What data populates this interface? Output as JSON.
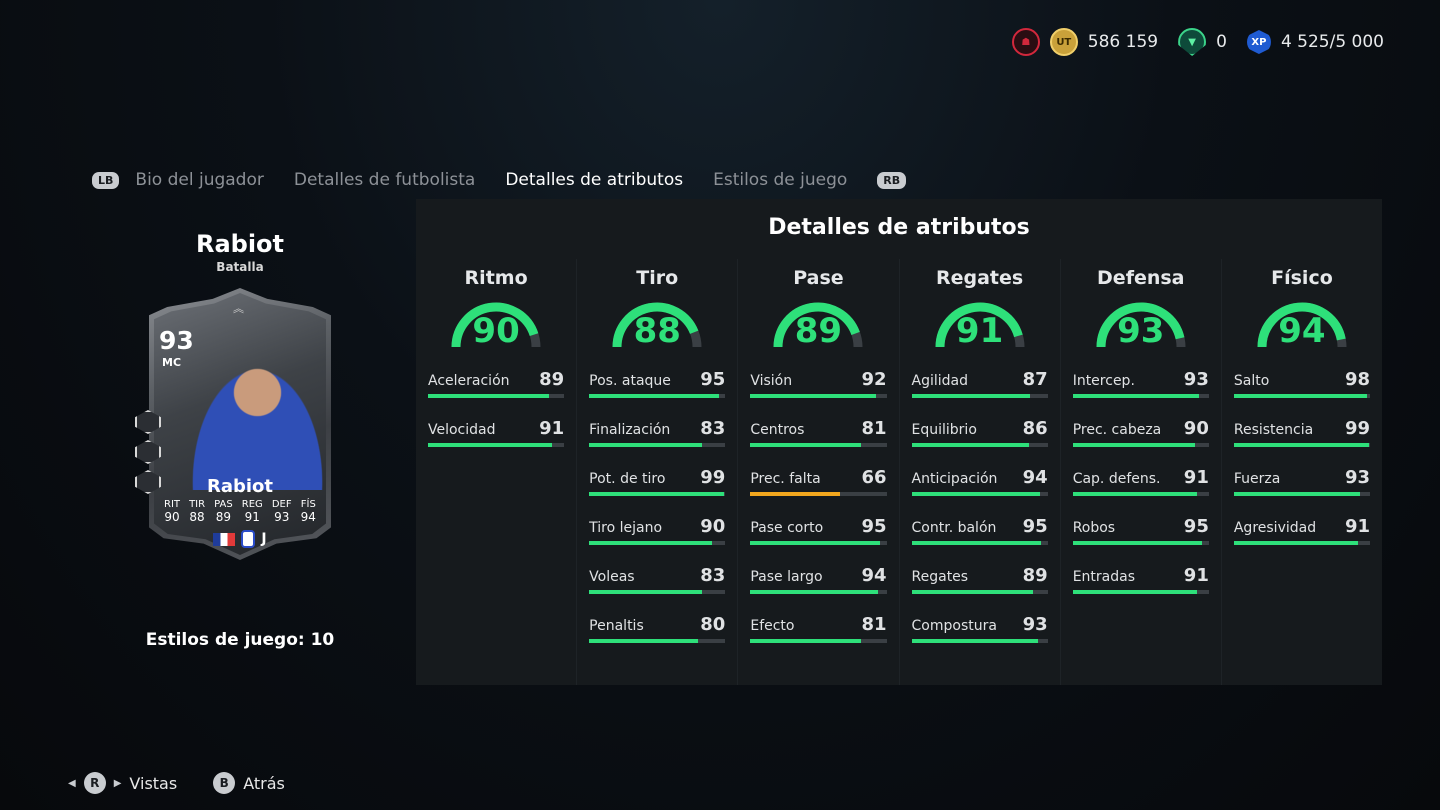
{
  "currency": {
    "coins": "586 159",
    "points": "0",
    "xp": "4 525/5 000",
    "coin_icon_text": "UT",
    "xp_icon_text": "XP"
  },
  "tabs": {
    "lb": "LB",
    "rb": "RB",
    "items": [
      {
        "label": "Bio del jugador",
        "active": false
      },
      {
        "label": "Detalles de futbolista",
        "active": false
      },
      {
        "label": "Detalles de atributos",
        "active": true
      },
      {
        "label": "Estilos de juego",
        "active": false
      }
    ]
  },
  "player": {
    "name": "Rabiot",
    "subtitle": "Batalla",
    "card": {
      "overall": "93",
      "position": "MC",
      "name": "Rabiot",
      "stats": [
        {
          "label": "RIT",
          "value": "90"
        },
        {
          "label": "TIR",
          "value": "88"
        },
        {
          "label": "PAS",
          "value": "89"
        },
        {
          "label": "REG",
          "value": "91"
        },
        {
          "label": "DEF",
          "value": "93"
        },
        {
          "label": "FÍS",
          "value": "94"
        }
      ]
    },
    "playstyles": "Estilos de juego: 10"
  },
  "panel": {
    "title": "Detalles de atributos",
    "categories": [
      {
        "name": "Ritmo",
        "value": 90,
        "attrs": [
          {
            "label": "Aceleración",
            "value": 89
          },
          {
            "label": "Velocidad",
            "value": 91
          }
        ]
      },
      {
        "name": "Tiro",
        "value": 88,
        "attrs": [
          {
            "label": "Pos. ataque",
            "value": 95
          },
          {
            "label": "Finalización",
            "value": 83
          },
          {
            "label": "Pot. de tiro",
            "value": 99
          },
          {
            "label": "Tiro lejano",
            "value": 90
          },
          {
            "label": "Voleas",
            "value": 83
          },
          {
            "label": "Penaltis",
            "value": 80
          }
        ]
      },
      {
        "name": "Pase",
        "value": 89,
        "attrs": [
          {
            "label": "Visión",
            "value": 92
          },
          {
            "label": "Centros",
            "value": 81
          },
          {
            "label": "Prec. falta",
            "value": 66,
            "color": "#f2a71e"
          },
          {
            "label": "Pase corto",
            "value": 95
          },
          {
            "label": "Pase largo",
            "value": 94
          },
          {
            "label": "Efecto",
            "value": 81
          }
        ]
      },
      {
        "name": "Regates",
        "value": 91,
        "attrs": [
          {
            "label": "Agilidad",
            "value": 87
          },
          {
            "label": "Equilibrio",
            "value": 86
          },
          {
            "label": "Anticipación",
            "value": 94
          },
          {
            "label": "Contr. balón",
            "value": 95
          },
          {
            "label": "Regates",
            "value": 89
          },
          {
            "label": "Compostura",
            "value": 93
          }
        ]
      },
      {
        "name": "Defensa",
        "value": 93,
        "attrs": [
          {
            "label": "Intercep.",
            "value": 93
          },
          {
            "label": "Prec. cabeza",
            "value": 90
          },
          {
            "label": "Cap. defens.",
            "value": 91
          },
          {
            "label": "Robos",
            "value": 95
          },
          {
            "label": "Entradas",
            "value": 91
          }
        ]
      },
      {
        "name": "Físico",
        "value": 94,
        "attrs": [
          {
            "label": "Salto",
            "value": 98
          },
          {
            "label": "Resistencia",
            "value": 99
          },
          {
            "label": "Fuerza",
            "value": 93
          },
          {
            "label": "Agresividad",
            "value": 91
          }
        ]
      }
    ]
  },
  "footer": {
    "views_button": "R",
    "views_label": "Vistas",
    "back_button": "B",
    "back_label": "Atrás"
  },
  "colors": {
    "accent": "#2ee07a",
    "warning": "#f2a71e",
    "panel_bg": "#161a1d"
  }
}
